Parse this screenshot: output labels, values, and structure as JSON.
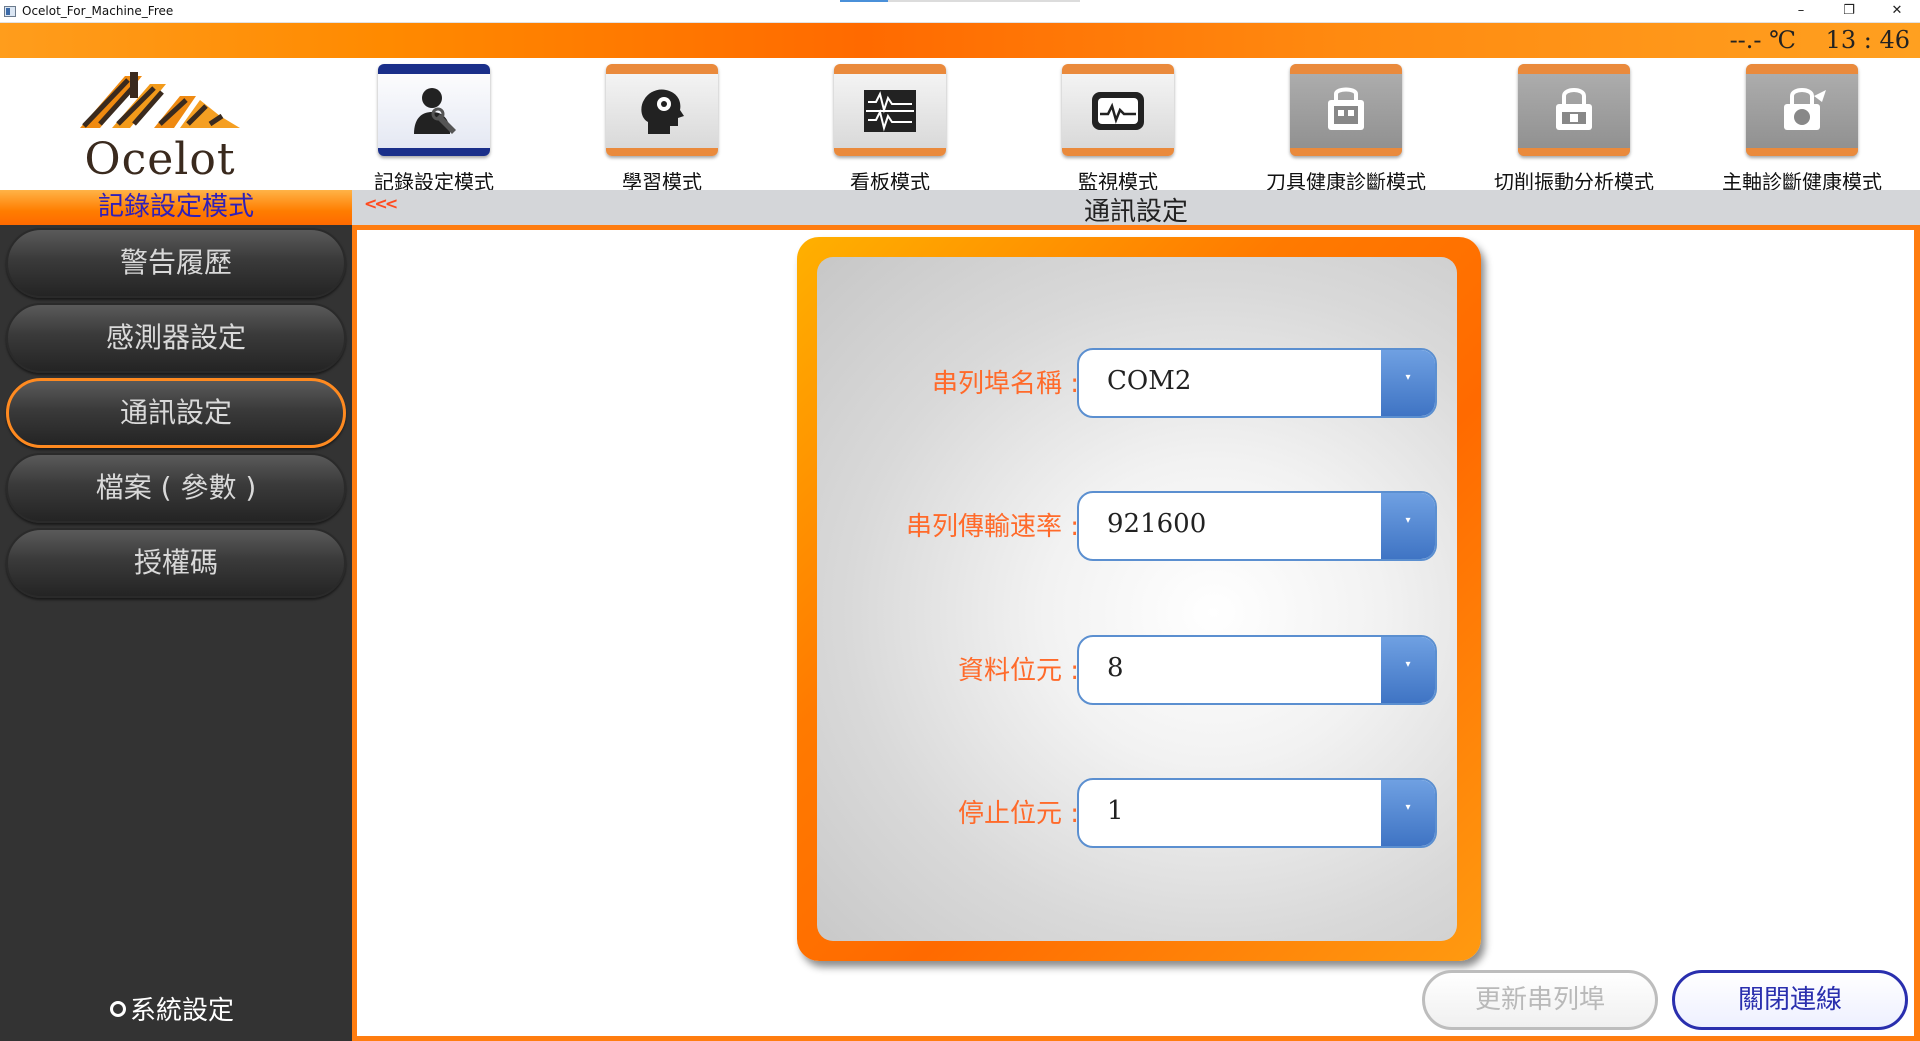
{
  "window": {
    "title": "Ocelot_For_Machine_Free",
    "minimize": "–",
    "restore": "❐",
    "close": "✕"
  },
  "status": {
    "temperature": "--.- ℃",
    "time": "13 : 46"
  },
  "logo": {
    "text": "Ocelot"
  },
  "modes": [
    {
      "label": "記錄設定模式",
      "icon": "user-wrench-icon",
      "state": "active"
    },
    {
      "label": "學習模式",
      "icon": "brain-gear-icon",
      "state": "normal"
    },
    {
      "label": "看板模式",
      "icon": "waveform-panel-icon",
      "state": "normal"
    },
    {
      "label": "監視模式",
      "icon": "monitor-wave-icon",
      "state": "normal"
    },
    {
      "label": "刀具健康診斷模式",
      "icon": "locked-tool-icon",
      "state": "disabled"
    },
    {
      "label": "切削振動分析模式",
      "icon": "locked-vibration-icon",
      "state": "disabled"
    },
    {
      "label": "主軸診斷健康模式",
      "icon": "locked-spindle-icon",
      "state": "disabled"
    }
  ],
  "sidebar": {
    "title": "記錄設定模式",
    "items": [
      {
        "label": "警告履歷"
      },
      {
        "label": "感測器設定"
      },
      {
        "label": "通訊設定"
      },
      {
        "label": "檔案 ( 參數 )"
      },
      {
        "label": "授權碼"
      }
    ],
    "active_index": 2,
    "system_settings": "系統設定"
  },
  "content": {
    "back": "<<<",
    "title": "通訊設定"
  },
  "form": {
    "fields": [
      {
        "label": "串列埠名稱 :",
        "value": "COM2"
      },
      {
        "label": "串列傳輸速率 :",
        "value": "921600"
      },
      {
        "label": "資料位元 :",
        "value": "8"
      },
      {
        "label": "停止位元 :",
        "value": "1"
      }
    ],
    "dropdown_arrow": "▾"
  },
  "buttons": {
    "refresh": "更新串列埠",
    "close": "關閉連線"
  },
  "colors": {
    "accent_orange": "#ff7d10",
    "active_blue": "#2a2fae",
    "label_orange": "#ff6a2a",
    "sidebar_bg": "#333333"
  }
}
